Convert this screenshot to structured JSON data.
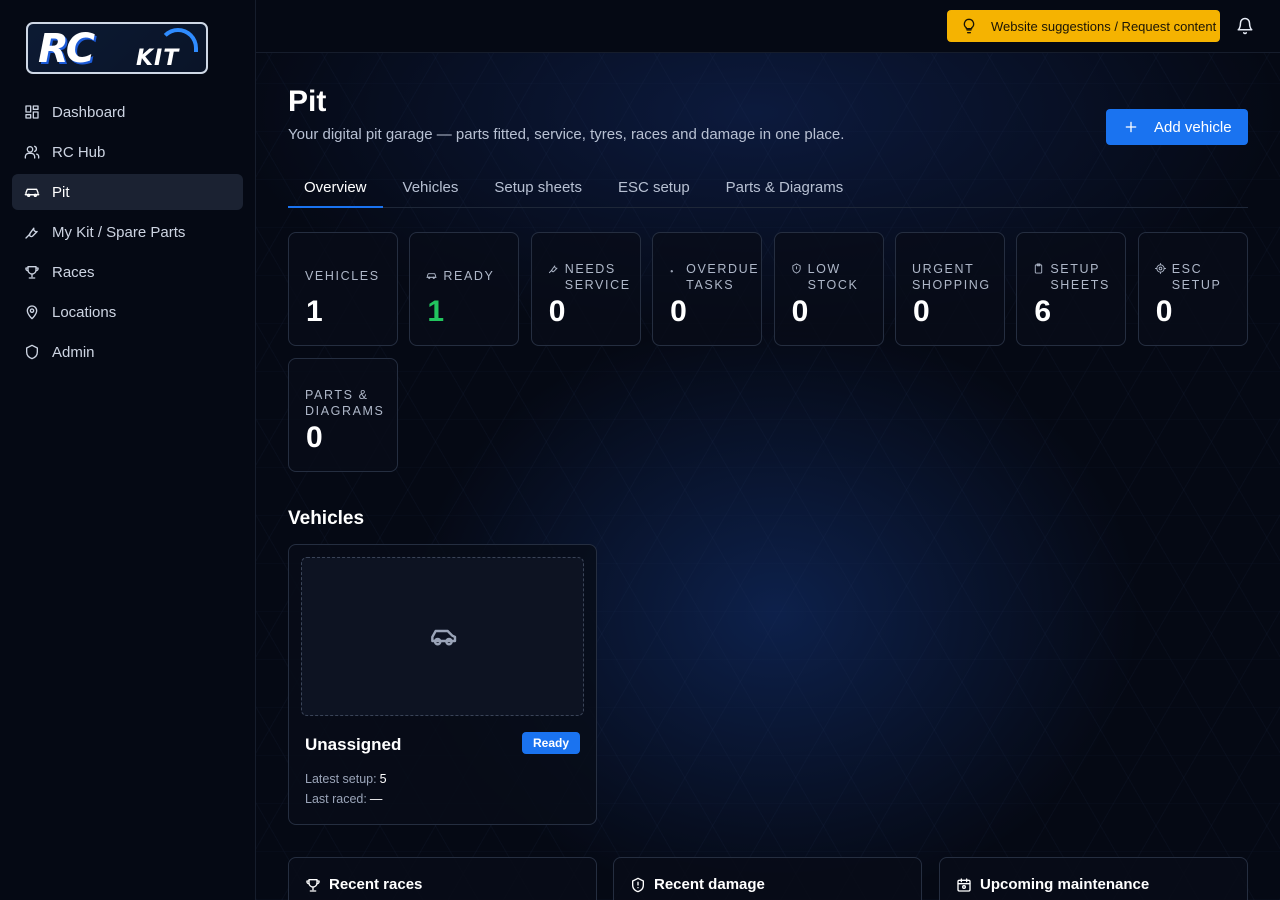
{
  "brand": {
    "logo_main": "RC",
    "logo_sub": "KIT"
  },
  "sidebar": {
    "items": [
      {
        "label": "Dashboard",
        "icon": "dashboard-icon"
      },
      {
        "label": "RC Hub",
        "icon": "users-icon"
      },
      {
        "label": "Pit",
        "icon": "car-icon",
        "active": true
      },
      {
        "label": "My Kit / Spare Parts",
        "icon": "wrench-icon"
      },
      {
        "label": "Races",
        "icon": "trophy-icon"
      },
      {
        "label": "Locations",
        "icon": "map-pin-icon"
      },
      {
        "label": "Admin",
        "icon": "shield-icon"
      }
    ]
  },
  "topbar": {
    "suggest_label": "Website suggestions / Request content",
    "suggest_icon": "lightbulb-icon",
    "bell_icon": "bell-icon",
    "accent": "#f5b301"
  },
  "page": {
    "title": "Pit",
    "subtitle": "Your digital pit garage — parts fitted, service, tyres, races and damage in one place.",
    "add_label": "Add vehicle",
    "accent": "#1a73f0"
  },
  "tabs": [
    {
      "label": "Overview",
      "active": true
    },
    {
      "label": "Vehicles"
    },
    {
      "label": "Setup sheets"
    },
    {
      "label": "ESC setup"
    },
    {
      "label": "Parts & Diagrams"
    }
  ],
  "stats": [
    {
      "label": "Vehicles",
      "value": "1"
    },
    {
      "label": "Ready",
      "value": "1",
      "icon": "car-icon",
      "color": "#22c55e"
    },
    {
      "label_1": "Needs",
      "label_2": "Service",
      "value": "0",
      "icon": "wrench-icon"
    },
    {
      "label_1": "Overdue",
      "label_2": "Tasks",
      "value": "0",
      "icon": "dot-icon"
    },
    {
      "label_1": "Low",
      "label_2": "Stock",
      "value": "0",
      "icon": "alert-icon"
    },
    {
      "label_1": "Urgent",
      "label_2": "Shopping",
      "value": "0"
    },
    {
      "label_1": "Setup",
      "label_2": "Sheets",
      "value": "6",
      "icon": "clipboard-icon"
    },
    {
      "label_1": "ESC",
      "label_2": "Setup",
      "value": "0",
      "icon": "gear-icon"
    },
    {
      "label_1": "Parts &",
      "label_2": "Diagrams",
      "value": "0"
    }
  ],
  "vehicles_section": {
    "title": "Vehicles",
    "cards": [
      {
        "name": "Unassigned",
        "status": "Ready",
        "latest_setup_label": "Latest setup:",
        "latest_setup_value": "5",
        "last_raced_label": "Last raced:",
        "last_raced_value": "—"
      }
    ]
  },
  "panels": [
    {
      "title": "Recent races",
      "icon": "trophy-icon"
    },
    {
      "title": "Recent damage",
      "icon": "shield-alert-icon"
    },
    {
      "title": "Upcoming maintenance",
      "icon": "calendar-icon"
    }
  ]
}
